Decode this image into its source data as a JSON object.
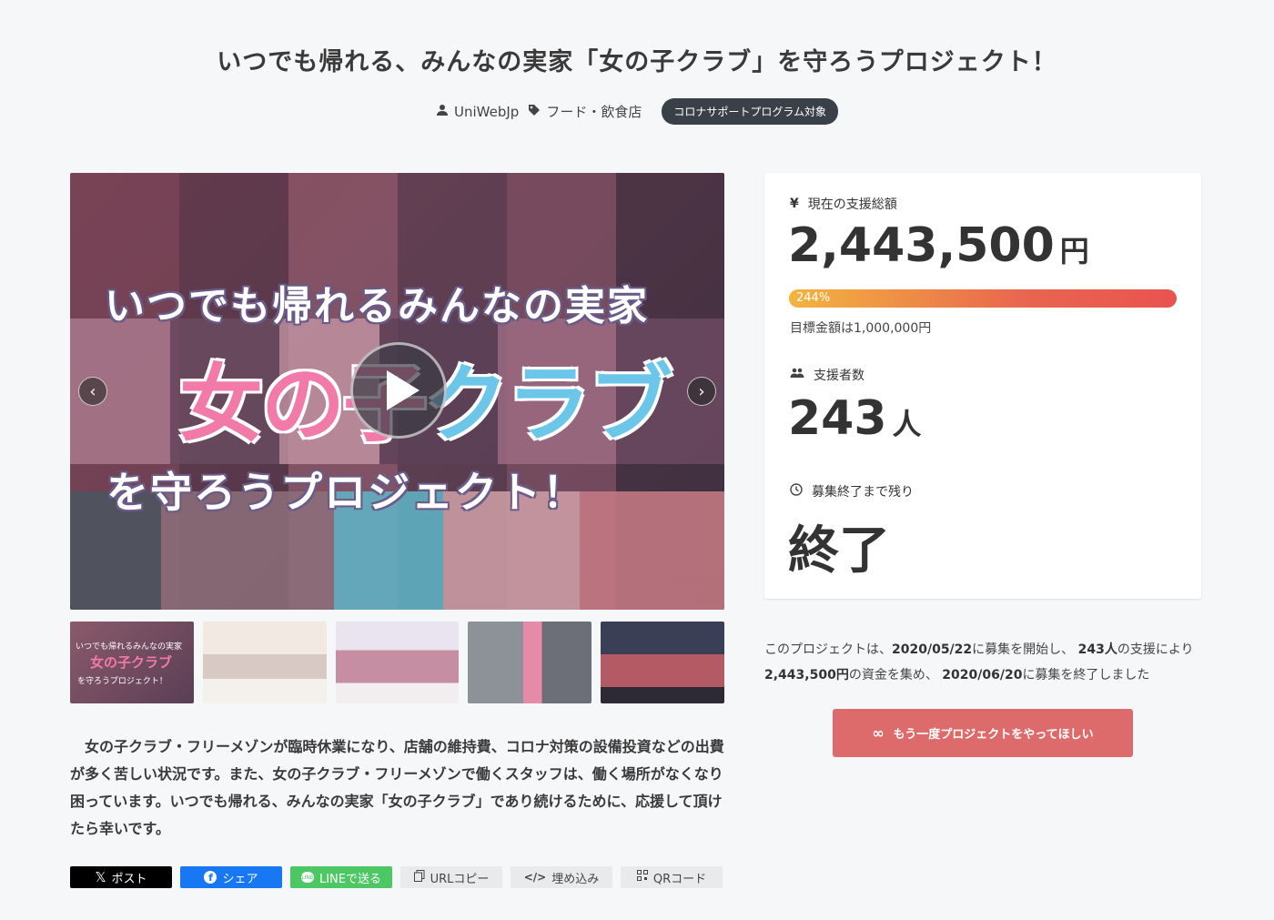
{
  "page": {
    "title": "いつでも帰れる、みんなの実家「女の子クラブ」を守ろうプロジェクト！",
    "author": "UniWebJp",
    "category": "フード・飲食店",
    "badge": "コロナサポートプログラム対象"
  },
  "hero": {
    "line1": "いつでも帰れるみんなの実家",
    "line2a": "女の子",
    "line2b": "クラブ",
    "line3": "を守ろうプロジェクト！",
    "prev_arrow": "‹",
    "next_arrow": "›"
  },
  "thumbnails": {
    "thumb1_line1": "いつでも帰れるみんなの実家",
    "thumb1_line2": "女の子クラブ",
    "thumb1_line3": "を守ろうプロジェクト！"
  },
  "description": "女の子クラブ・フリーメゾンが臨時休業になり、店舗の維持費、コロナ対策の設備投資などの出費が多く苦しい状況です。また、女の子クラブ・フリーメゾンで働くスタッフは、働く場所がなくなり困っています。いつでも帰れる、みんなの実家「女の子クラブ」であり続けるために、応援して頂けたら幸いです。",
  "share": {
    "x": "ポスト",
    "facebook": "シェア",
    "line": "LINEで送る",
    "url_copy": "URLコピー",
    "embed": "埋め込み",
    "qr": "QRコード"
  },
  "stats": {
    "total_label": "現在の支援総額",
    "total_value": "2,443,500",
    "total_unit": "円",
    "progress_label": "244%",
    "progress_fraction": 1.0,
    "goal_text": "目標金額は1,000,000円",
    "supporters_label": "支援者数",
    "supporters_value": "243",
    "supporters_unit": "人",
    "remaining_label": "募集終了まで残り",
    "remaining_value": "終了"
  },
  "summary": {
    "p1": "このプロジェクトは、",
    "start_date": "2020/05/22",
    "p2": "に募集を開始し、",
    "supporters": "243人",
    "p3": "の支援により",
    "amount": "2,443,500円",
    "p4": "の資金を集め、",
    "end_date": "2020/06/20",
    "p5": "に募集を終了しました"
  },
  "again_button": "もう一度プロジェクトをやってほしい",
  "colors": {
    "accent": "#dd6b6b",
    "badge_bg": "#3a4047",
    "progress_start": "#f3b53e",
    "progress_end": "#e9534f"
  }
}
